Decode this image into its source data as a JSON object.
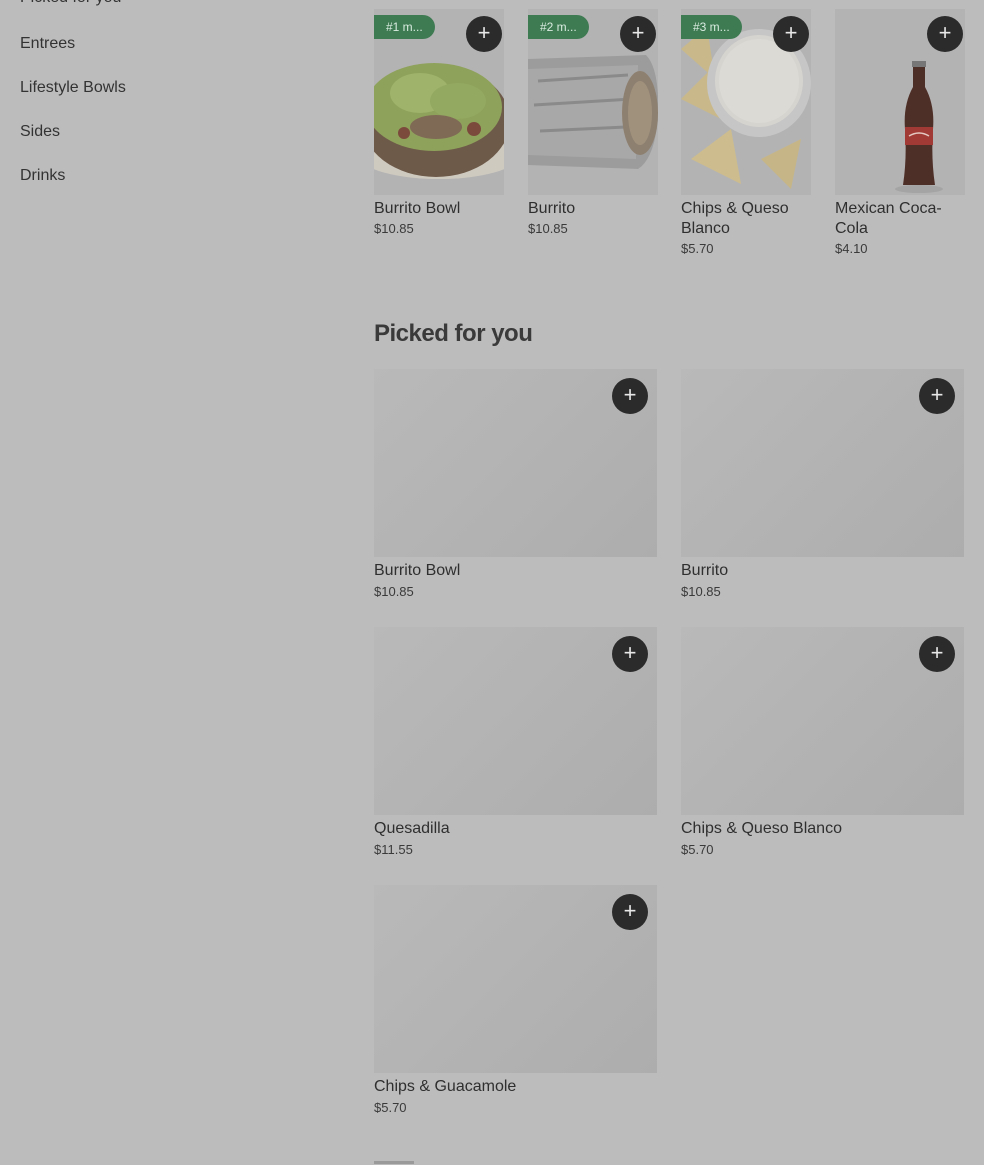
{
  "sidebar": {
    "items": [
      {
        "label": "Picked for you"
      },
      {
        "label": "Entrees"
      },
      {
        "label": "Lifestyle Bowls"
      },
      {
        "label": "Sides"
      },
      {
        "label": "Drinks"
      }
    ]
  },
  "carousel": {
    "items": [
      {
        "badge": "#1 m...",
        "name": "Burrito Bowl",
        "price": "$10.85",
        "image": "burrito-bowl-photo"
      },
      {
        "badge": "#2 m...",
        "name": "Burrito",
        "price": "$10.85",
        "image": "burrito-photo"
      },
      {
        "badge": "#3 m...",
        "name": "Chips & Queso Blanco",
        "price": "$5.70",
        "image": "chips-queso-photo"
      },
      {
        "badge": "",
        "name": "Mexican Coca-Cola",
        "price": "$4.10",
        "image": "coca-cola-bottle-photo"
      }
    ]
  },
  "picked_for_you": {
    "title": "Picked for you",
    "items": [
      {
        "name": "Burrito Bowl",
        "price": "$10.85"
      },
      {
        "name": "Burrito",
        "price": "$10.85"
      },
      {
        "name": "Quesadilla",
        "price": "$11.55"
      },
      {
        "name": "Chips & Queso Blanco",
        "price": "$5.70"
      },
      {
        "name": "Chips & Guacamole",
        "price": "$5.70"
      }
    ]
  },
  "add_button_icon": "plus-icon",
  "colors": {
    "badge_green": "#3e7a52",
    "add_button": "#2b2b2b",
    "overlay_background": "#bcbcbc"
  }
}
